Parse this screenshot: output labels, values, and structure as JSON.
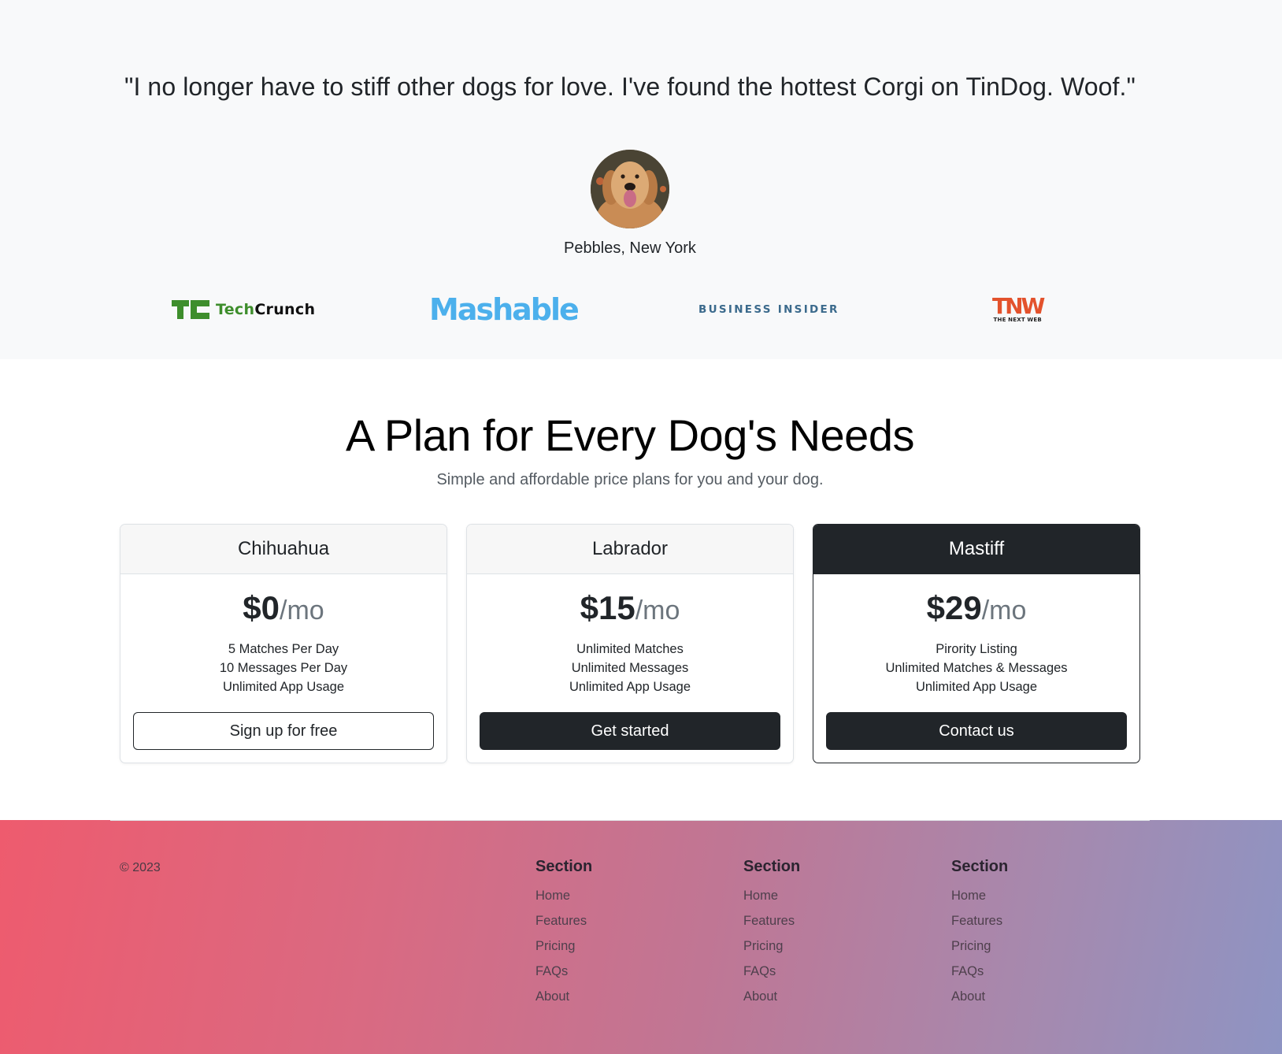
{
  "testimonial": {
    "quote": "\"I no longer have to stiff other dogs for love. I've found the hottest Corgi on TinDog. Woof.\"",
    "author": "Pebbles, New York",
    "avatar_icon": "dog-avatar-photo"
  },
  "press": {
    "logos": [
      {
        "name": "TechCrunch",
        "part1": "Tech",
        "part2": "Crunch",
        "color": "#3e8e2c"
      },
      {
        "name": "Mashable",
        "text": "Mashable",
        "color": "#4cb0ec"
      },
      {
        "name": "Business Insider",
        "text": "BUSINESS INSIDER",
        "color": "#3b6a8c"
      },
      {
        "name": "The Next Web",
        "text": "TNW",
        "subtext": "THE NEXT WEB",
        "color": "#e3522c"
      }
    ]
  },
  "pricing": {
    "title": "A Plan for Every Dog's Needs",
    "subtitle": "Simple and affordable price plans for you and your dog.",
    "plans": [
      {
        "name": "Chihuahua",
        "price": "$0",
        "period": "/mo",
        "features": [
          "5 Matches Per Day",
          "10 Messages Per Day",
          "Unlimited App Usage"
        ],
        "button": "Sign up for free"
      },
      {
        "name": "Labrador",
        "price": "$15",
        "period": "/mo",
        "features": [
          "Unlimited Matches",
          "Unlimited Messages",
          "Unlimited App Usage"
        ],
        "button": "Get started"
      },
      {
        "name": "Mastiff",
        "price": "$29",
        "period": "/mo",
        "features": [
          "Pirority Listing",
          "Unlimited Matches & Messages",
          "Unlimited App Usage"
        ],
        "button": "Contact us"
      }
    ]
  },
  "footer": {
    "copyright": "© 2023",
    "gradient": [
      "#ee5b6e",
      "#8e94c3"
    ],
    "columns": [
      {
        "heading": "Section",
        "links": [
          "Home",
          "Features",
          "Pricing",
          "FAQs",
          "About"
        ]
      },
      {
        "heading": "Section",
        "links": [
          "Home",
          "Features",
          "Pricing",
          "FAQs",
          "About"
        ]
      },
      {
        "heading": "Section",
        "links": [
          "Home",
          "Features",
          "Pricing",
          "FAQs",
          "About"
        ]
      }
    ]
  }
}
